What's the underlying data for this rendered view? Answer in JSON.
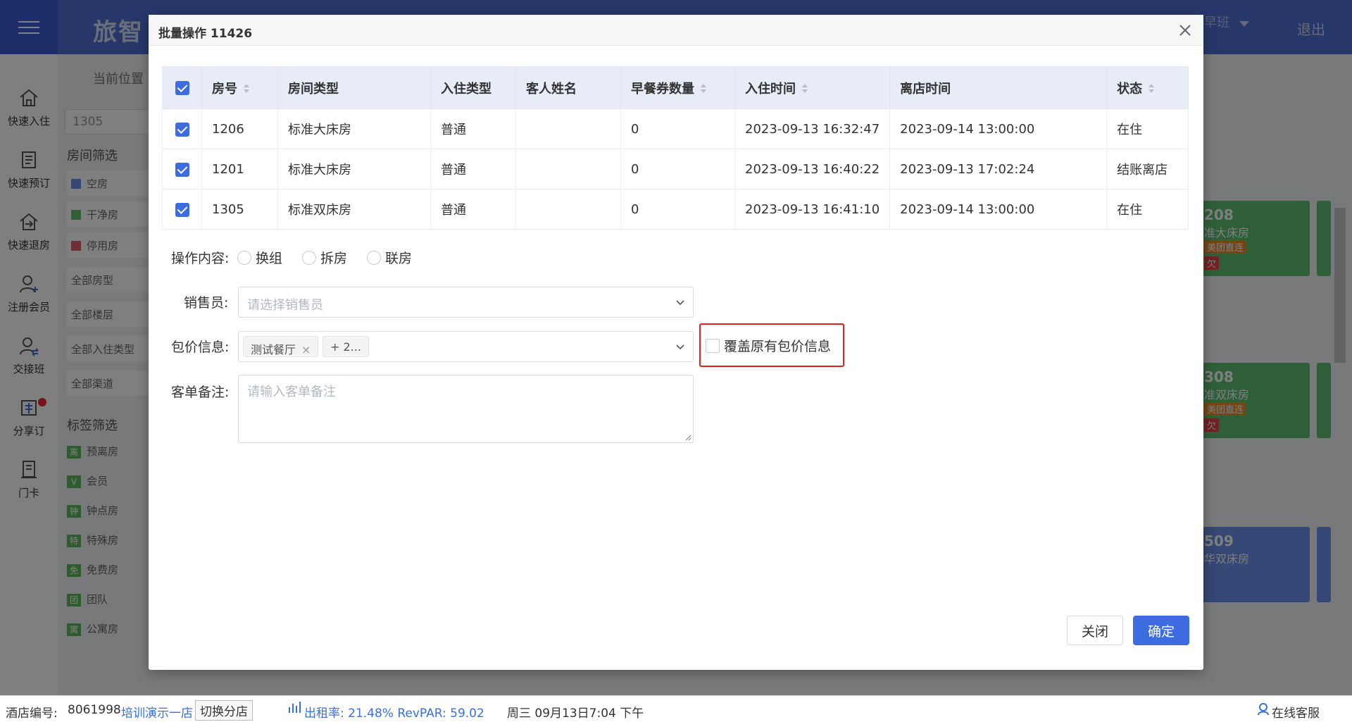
{
  "header": {
    "brand": "旅智",
    "shift": "早班",
    "logout": "退出"
  },
  "leftrail": {
    "items": [
      {
        "label": "快速入住",
        "icon": "home-icon"
      },
      {
        "label": "快速预订",
        "icon": "booking-icon"
      },
      {
        "label": "快速退房",
        "icon": "checkout-icon"
      },
      {
        "label": "注册会员",
        "icon": "add-user-icon"
      },
      {
        "label": "交接班",
        "icon": "handover-icon"
      },
      {
        "label": "分享订",
        "icon": "share-order-icon"
      },
      {
        "label": "门卡",
        "icon": "door-card-icon"
      }
    ]
  },
  "background": {
    "breadcrumb": "当前位置",
    "search_value": "1305",
    "room_filter_title": "房间筛选",
    "room_filters": [
      "空房",
      "干净房",
      "停用房"
    ],
    "selects": [
      "全部房型",
      "全部楼层",
      "全部入住类型",
      "全部渠道"
    ],
    "tag_filter_title": "标签筛选",
    "tags": [
      {
        "icon": "离",
        "label": "预离房"
      },
      {
        "icon": "V",
        "label": "会员"
      },
      {
        "icon": "钟",
        "label": "钟点房"
      },
      {
        "icon": "特",
        "label": "特殊房"
      },
      {
        "icon": "免",
        "label": "免费房"
      },
      {
        "icon": "团",
        "label": "团队"
      },
      {
        "icon": "寓",
        "label": "公寓房"
      }
    ],
    "cards": [
      {
        "num": "208",
        "type": "准大床房",
        "tag": "美团直连",
        "owe": "欠"
      },
      {
        "num": "308",
        "type": "准双床房",
        "tag": "美团直连",
        "owe": "欠"
      },
      {
        "num": "509",
        "type": "华双床房"
      }
    ]
  },
  "statusbar": {
    "hotel_no_label": "酒店编号:",
    "hotel_no": "8061998",
    "store": "培训演示一店",
    "switch_store": "切换分店",
    "occupancy": "出租率: 21.48% RevPAR: 59.02",
    "datetime": "周三 09月13日7:04 下午",
    "support": "在线客服"
  },
  "modal": {
    "title": "批量操作 11426",
    "columns": [
      "房号",
      "房间类型",
      "入住类型",
      "客人姓名",
      "早餐券数量",
      "入住时间",
      "离店时间",
      "状态"
    ],
    "rows": [
      [
        "1206",
        "标准大床房",
        "普通",
        "",
        "0",
        "2023-09-13 16:32:47",
        "2023-09-14 13:00:00",
        "在住"
      ],
      [
        "1201",
        "标准大床房",
        "普通",
        "",
        "0",
        "2023-09-13 16:40:22",
        "2023-09-13 17:02:24",
        "结账离店"
      ],
      [
        "1305",
        "标准双床房",
        "普通",
        "",
        "0",
        "2023-09-13 16:41:10",
        "2023-09-14 13:00:00",
        "在住"
      ]
    ],
    "operation_label": "操作内容:",
    "operations": [
      "换组",
      "拆房",
      "联房"
    ],
    "salesperson_label": "销售员:",
    "salesperson_placeholder": "请选择销售员",
    "package_label": "包价信息:",
    "package_tags": [
      "测试餐厅",
      "+ 2..."
    ],
    "cover_label": "覆盖原有包价信息",
    "remark_label": "客单备注:",
    "remark_placeholder": "请输入客单备注",
    "close_button": "关闭",
    "confirm_button": "确定"
  },
  "colors": {
    "primary": "#3d6ce0",
    "header": "#4f6ed4",
    "highlight": "#e81c1c",
    "room_green": "#5fbf70",
    "room_blue": "#6b8ee8"
  }
}
